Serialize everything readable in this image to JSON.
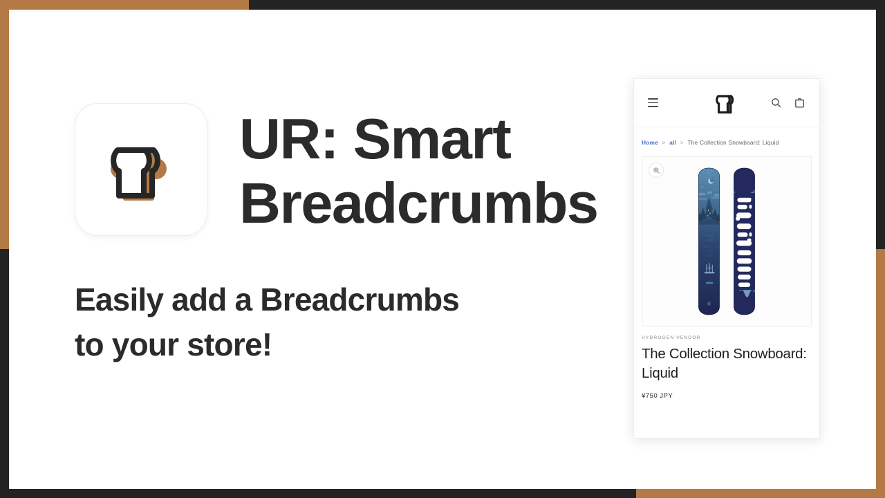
{
  "background": {
    "accent_color": "#b37a45",
    "dark_color": "#232324",
    "page_color": "#ffffff"
  },
  "hero": {
    "app_icon_name": "bread-slice-logo",
    "title": "UR: Smart Breadcrumbs",
    "subtitle_line1": "Easily add a Breadcrumbs",
    "subtitle_line2": "to your store!",
    "subtitle": "Easily add a Breadcrumbs to your store!"
  },
  "store_card": {
    "header": {
      "menu_label": "Menu",
      "logo_name": "bread-slice-logo",
      "search_label": "Search",
      "cart_label": "Cart"
    },
    "breadcrumb": {
      "items": [
        {
          "label": "Home",
          "type": "link"
        },
        {
          "label": "all",
          "type": "link"
        },
        {
          "label": "The Collection Snowboard: Liquid",
          "type": "current"
        }
      ],
      "separator": ">"
    },
    "media": {
      "zoom_label": "Zoom",
      "board_left_alt": "Snowboard front with forest and moon artwork",
      "board_right_alt": "Snowboard back with liquid logo artwork",
      "brand_text": "liquid"
    },
    "product": {
      "vendor": "HYDROGEN VENDOR",
      "title": "The Collection Snowboard: Liquid",
      "price": "¥750 JPY"
    }
  }
}
